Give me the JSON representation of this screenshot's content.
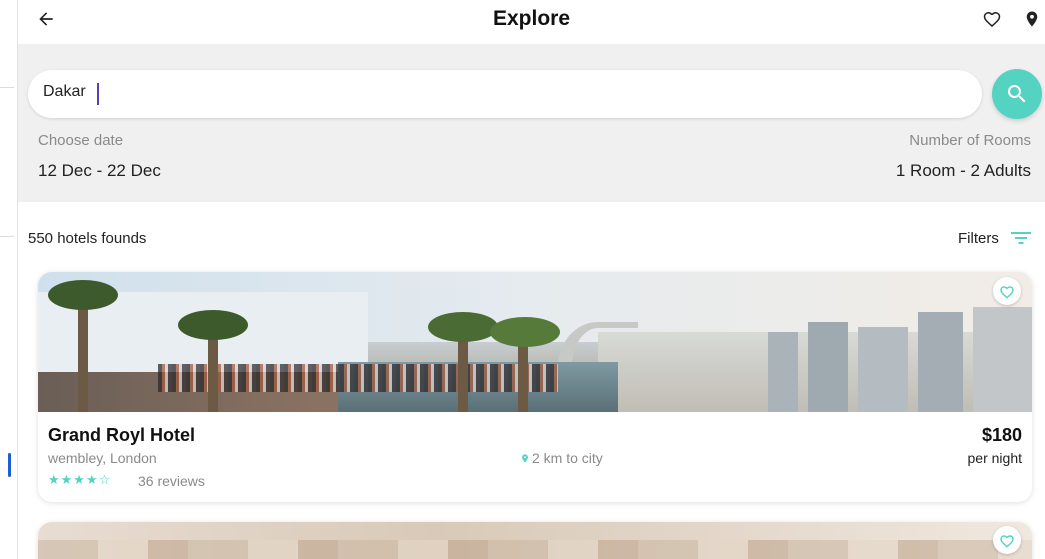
{
  "colors": {
    "accent": "#54d3c2",
    "background_search": "#f0f0f0",
    "caret": "#5a3fb0",
    "sidebar_indicator": "#1a5fd6"
  },
  "appbar": {
    "title": "Explore",
    "icons": {
      "back": "arrow-left-icon",
      "favorite": "heart-outline-icon",
      "location": "map-pin-icon"
    }
  },
  "search": {
    "value": "Dakar",
    "placeholder": "",
    "icon": "search-icon"
  },
  "date": {
    "label": "Choose date",
    "value": "12 Dec - 22 Dec"
  },
  "rooms": {
    "label": "Number of Rooms",
    "value": "1 Room - 2 Adults"
  },
  "results": {
    "count": "550 hotels founds",
    "filters_label": "Filters",
    "filters_icon": "filter-lines-icon"
  },
  "hotels": [
    {
      "name": "Grand Royl Hotel",
      "location": "wembley, London",
      "distance": "2 km to city",
      "price": "$180",
      "price_unit": "per night",
      "rating": 4,
      "rating_max": 5,
      "stars_text": "★★★★☆",
      "reviews": "36 reviews",
      "favorite_icon": "heart-outline-icon"
    },
    {
      "favorite_icon": "heart-outline-icon"
    }
  ]
}
